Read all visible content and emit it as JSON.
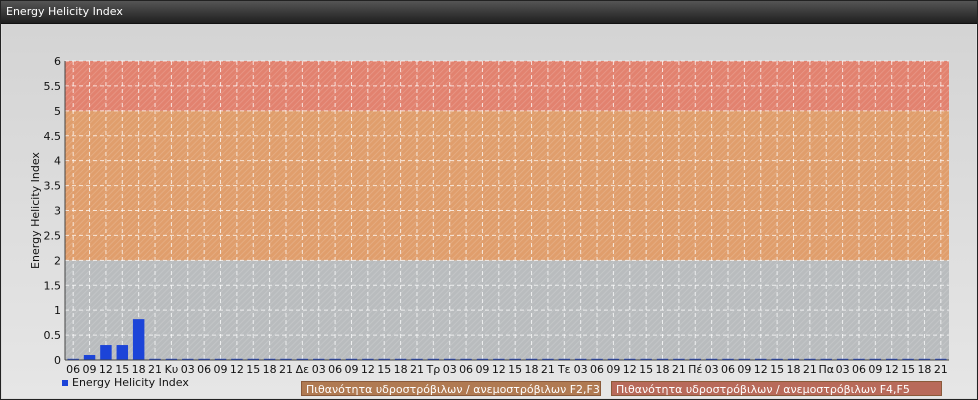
{
  "window": {
    "title": "Energy Helicity Index"
  },
  "colors": {
    "bar": "#1c44d8",
    "band_low": "#b9bcbe",
    "band_mid": "#e09e6c",
    "band_high": "#e2826f"
  },
  "legend": {
    "series_label": "Energy Helicity Index",
    "band_mid_label": "Πιθανότητα υδροστρόβιλων / ανεμοστρόβιλων F2,F3",
    "band_high_label": "Πιθανότητα υδροστρόβιλων / ανεμοστρόβιλων F4,F5"
  },
  "chart_data": {
    "type": "bar",
    "title": "",
    "ylabel": "Energy Helicity Index",
    "xlabel": "",
    "ylim": [
      0,
      6
    ],
    "yticks": [
      "0",
      "0.5",
      "1",
      "1.5",
      "2",
      "2.5",
      "3",
      "3.5",
      "4",
      "4.5",
      "5",
      "5.5",
      "6"
    ],
    "bands": [
      {
        "from": 0,
        "to": 2,
        "color": "#b9bcbe"
      },
      {
        "from": 2,
        "to": 5,
        "color": "#e09e6c",
        "label": "Πιθανότητα υδροστρόβιλων / ανεμοστρόβιλων F2,F3"
      },
      {
        "from": 5,
        "to": 6,
        "color": "#e2826f",
        "label": "Πιθανότητα υδροστρόβιλων / ανεμοστρόβιλων F4,F5"
      }
    ],
    "categories": [
      "06",
      "09",
      "12",
      "15",
      "18",
      "21",
      "Κυ",
      "03",
      "06",
      "09",
      "12",
      "15",
      "18",
      "21",
      "Δε",
      "03",
      "06",
      "09",
      "12",
      "15",
      "18",
      "21",
      "Τρ",
      "03",
      "06",
      "09",
      "12",
      "15",
      "18",
      "21",
      "Τε",
      "03",
      "06",
      "09",
      "12",
      "15",
      "18",
      "21",
      "Πέ",
      "03",
      "06",
      "09",
      "12",
      "15",
      "18",
      "21",
      "Πα",
      "03",
      "06",
      "09",
      "12",
      "15",
      "18",
      "21"
    ],
    "series": [
      {
        "name": "Energy Helicity Index",
        "values": [
          0,
          0.1,
          0.3,
          0.3,
          0.82,
          0,
          0,
          0,
          0,
          0,
          0,
          0,
          0,
          0,
          0,
          0,
          0,
          0,
          0,
          0,
          0,
          0,
          0,
          0,
          0,
          0,
          0,
          0,
          0,
          0,
          0,
          0,
          0,
          0,
          0,
          0,
          0,
          0,
          0,
          0,
          0,
          0,
          0,
          0,
          0,
          0,
          0,
          0,
          0,
          0,
          0,
          0,
          0,
          0
        ]
      }
    ],
    "grid": true,
    "legend_position": "bottom-left"
  }
}
